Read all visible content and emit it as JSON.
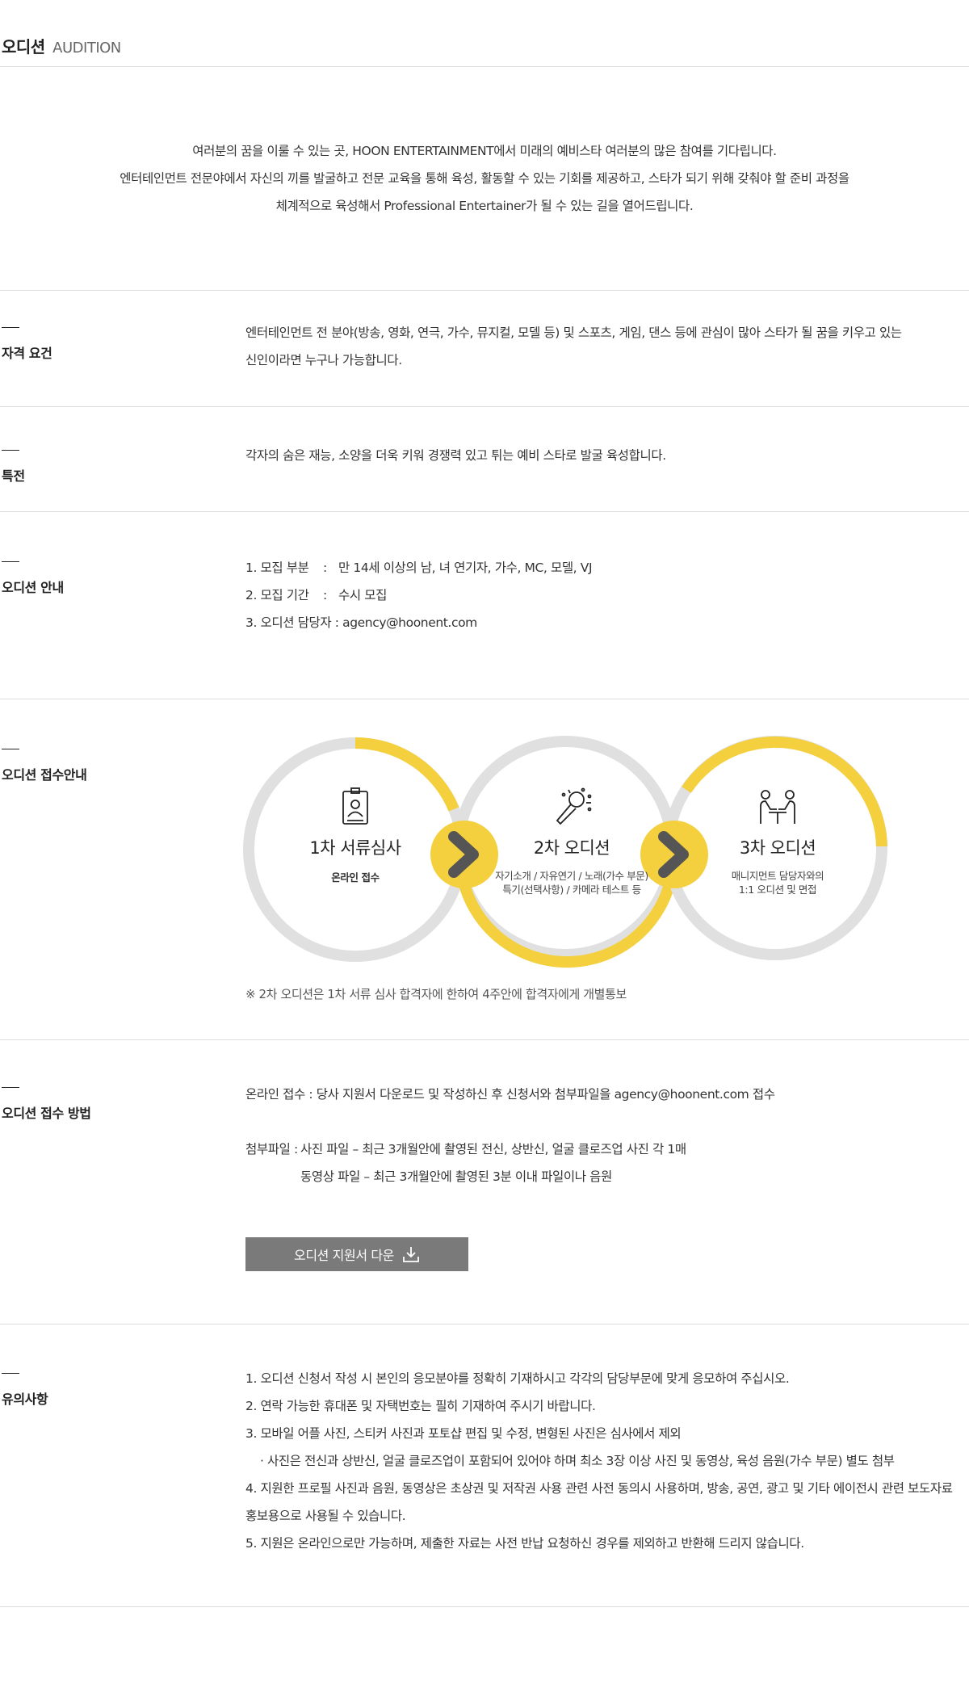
{
  "header": {
    "title": "오디션",
    "subtitle": "AUDITION"
  },
  "intro": {
    "lines": [
      "여러분의 꿈을 이룰 수 있는 곳, HOON ENTERTAINMENT에서 미래의 예비스타 여러분의 많은 참여를 기다립니다.",
      "엔터테인먼트 전문야에서 자신의 끼를 발굴하고 전문 교육을 통해 육성, 활동할 수 있는 기회를 제공하고, 스타가 되기 위해 갖춰야 할 준비 과정을",
      "체계적으로 육성해서 Professional Entertainer가 될 수 있는 길을 열어드립니다."
    ]
  },
  "qualification": {
    "title": "자격 요건",
    "lines": [
      "엔터테인먼트 전 분야(방송, 영화, 연극, 가수, 뮤지컬, 모델 등) 및 스포츠, 게임, 댄스 등에 관심이 많아 스타가 될 꿈을 키우고 있는",
      "신인이라면 누구나 가능합니다."
    ]
  },
  "benefits": {
    "title": "특전",
    "text": "각자의 숨은 재능, 소양을 더욱 키워 경쟁력 있고 튀는 예비 스타로 발굴 육성합니다."
  },
  "guide": {
    "title": "오디션 안내",
    "rows": [
      {
        "label": "1. 모집 부분",
        "sep": ":",
        "value": "만 14세 이상의 남, 녀 연기자, 가수, MC, 모델, VJ"
      },
      {
        "label": "2. 모집 기간",
        "sep": ":",
        "value": "수시 모집"
      },
      {
        "label": "3. 오디션 담당자 :",
        "sep": "",
        "value": "agency@hoonent.com"
      }
    ]
  },
  "process": {
    "title": "오디션 접수안내",
    "steps": [
      {
        "title": "1차 서류심사",
        "desc": [
          "온라인 접수"
        ],
        "icon": "id-badge-icon"
      },
      {
        "title": "2차 오디션",
        "desc": [
          "자기소개 / 자유연기 / 노래(가수 부문)",
          "특기(선택사항) / 카메라 테스트 등"
        ],
        "icon": "microphone-icon"
      },
      {
        "title": "3차 오디션",
        "desc": [
          "매니지먼트 담당자와의",
          "1:1 오디션 및 면접"
        ],
        "icon": "interview-icon"
      }
    ],
    "note": "※ 2차 오디션은 1차 서류 심사 합격자에 한하여 4주안에 합격자에게 개별통보",
    "colors": {
      "accent": "#f4cf3e",
      "track": "#e0e0e0",
      "arrow": "#555555"
    }
  },
  "method": {
    "title": "오디션 접수 방법",
    "online_label": "온라인 접수 :",
    "online_text": "당사 지원서 다운로드 및 작성하신 후 신청서와 첨부파일을 agency@hoonent.com 접수",
    "attach_label": "첨부파일 :",
    "attach_lines": [
      "사진 파일 – 최근 3개월안에 촬영된 전신, 상반신, 얼굴 클로즈업 사진 각 1매",
      "동영상 파일 – 최근 3개월안에 촬영된 3분 이내 파일이나 음원"
    ],
    "button_label": "오디션 지원서 다운"
  },
  "notice": {
    "title": "유의사항",
    "lines": [
      "1. 오디션 신청서 작성 시 본인의 응모분야를 정확히 기재하시고 각각의 담당부문에 맞게 응모하여 주십시오.",
      "2. 연락 가능한 휴대폰 및 자택번호는 필히 기재하여 주시기 바랍니다.",
      "3. 모바일 어플 사진, 스티커 사진과 포토샵 편집 및 수정, 변형된 사진은 심사에서 제외",
      "· 사진은 전신과 상반신, 얼굴 클로즈업이 포함되어 있어야 하며 최소 3장 이상 사진 및 동영상, 육성 음원(가수 부문) 별도 첨부",
      "4. 지원한 프로필 사진과 음원, 동영상은 초상권 및 저작권 사용 관련 사전 동의시 사용하며, 방송, 공연, 광고 및 기타 에이전시 관련 보도자료",
      "홍보용으로 사용될 수 있습니다.",
      "5. 지원은 온라인으로만 가능하며, 제출한 자료는 사전 반납 요청하신 경우를 제외하고 반환해 드리지 않습니다."
    ]
  }
}
